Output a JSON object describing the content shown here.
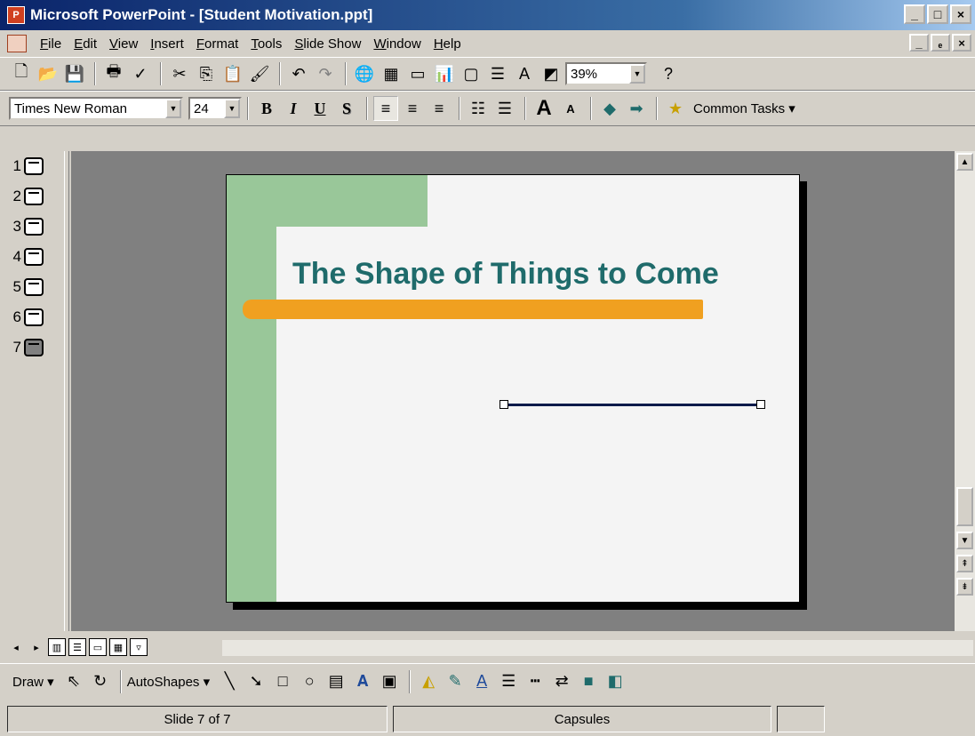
{
  "window": {
    "title": "Microsoft PowerPoint - [Student Motivation.ppt]",
    "min": "_",
    "max": "□",
    "close": "×",
    "doc_min": "_",
    "doc_restore": "ₑ",
    "doc_close": "×"
  },
  "menu": [
    "File",
    "Edit",
    "View",
    "Insert",
    "Format",
    "Tools",
    "Slide Show",
    "Window",
    "Help"
  ],
  "toolbar": {
    "zoom": "39%",
    "help": "?"
  },
  "formatting": {
    "font": "Times New Roman",
    "size": "24",
    "bold": "B",
    "italic": "I",
    "underline": "U",
    "shadow": "S",
    "increase_font": "A",
    "decrease_font": "A",
    "common_tasks": "Common Tasks ▾"
  },
  "outline": {
    "slides": [
      "1",
      "2",
      "3",
      "4",
      "5",
      "6",
      "7"
    ],
    "selected": 7
  },
  "slide": {
    "title": "The Shape of Things to Come",
    "colors": {
      "green": "#99c799",
      "orange": "#f0a020",
      "title": "#1f6b6b",
      "line": "#0a1a4a"
    }
  },
  "drawing": {
    "draw_label": "Draw ▾",
    "autoshapes_label": "AutoShapes ▾"
  },
  "status": {
    "slide_info": "Slide 7 of 7",
    "design": "Capsules"
  }
}
